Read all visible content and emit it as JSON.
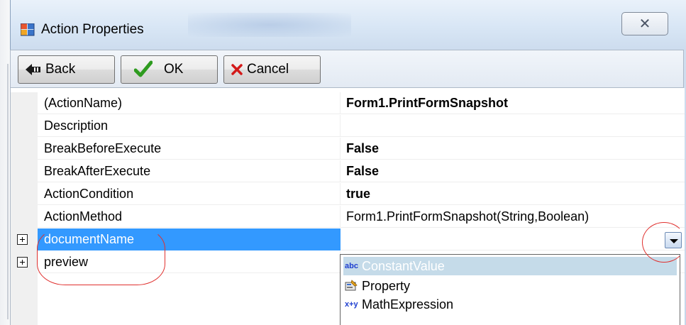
{
  "window": {
    "title": "Action Properties",
    "close_glyph": "✕"
  },
  "toolbar": {
    "back_label": "Back",
    "ok_label": "OK",
    "cancel_label": "Cancel"
  },
  "grid": {
    "rows": [
      {
        "name": "(ActionName)",
        "value": "Form1.PrintFormSnapshot",
        "bold": true
      },
      {
        "name": "Description",
        "value": "",
        "bold": false
      },
      {
        "name": "BreakBeforeExecute",
        "value": "False",
        "bold": true
      },
      {
        "name": "BreakAfterExecute",
        "value": "False",
        "bold": true
      },
      {
        "name": "ActionCondition",
        "value": "true",
        "bold": true
      },
      {
        "name": "ActionMethod",
        "value": "Form1.PrintFormSnapshot(String,Boolean)",
        "bold": false
      },
      {
        "name": "documentName",
        "value": "",
        "expandable": true,
        "selected": true
      },
      {
        "name": "preview",
        "value": "",
        "expandable": true
      }
    ]
  },
  "dropdown": {
    "items": [
      {
        "label": "ConstantValue",
        "icon": "abc-icon",
        "icon_text": "abc",
        "selected": true
      },
      {
        "label": "Property",
        "icon": "property-icon",
        "icon_text": "",
        "selected": false
      },
      {
        "label": "MathExpression",
        "icon": "math-expression-icon",
        "icon_text": "x+y",
        "selected": false
      }
    ]
  },
  "colors": {
    "selection": "#3399ff",
    "annotation": "#e0302e",
    "dropdown_highlight": "#c5dbe9"
  }
}
